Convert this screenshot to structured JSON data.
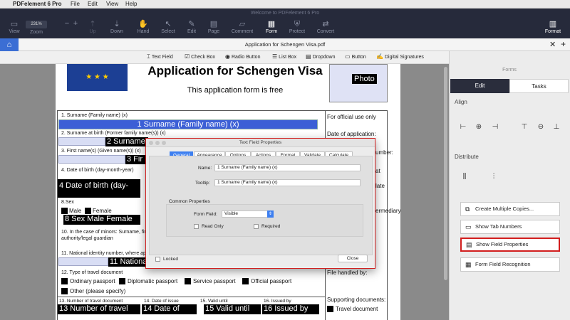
{
  "macbar": {
    "app_name": "PDFelement 6 Pro",
    "menus": [
      "File",
      "Edit",
      "View",
      "Help"
    ]
  },
  "window": {
    "title": "Welcome to PDFelement 6 Pro"
  },
  "toolbar": {
    "zoom_value": "231%",
    "items": {
      "view": "View",
      "zoom": "Zoom",
      "up": "Up",
      "down": "Down",
      "hand": "Hand",
      "select": "Select",
      "edit": "Edit",
      "page": "Page",
      "comment": "Comment",
      "form": "Form",
      "protect": "Protect",
      "convert": "Convert",
      "format": "Format"
    }
  },
  "tab": {
    "filename": "Application for Schengen Visa.pdf"
  },
  "formbar": {
    "text_field": "Text Field",
    "check_box": "Check Box",
    "radio_button": "Radio Button",
    "list_box": "List Box",
    "dropdown": "Dropdown",
    "button": "Button",
    "digital_signatures": "Digital Signatures"
  },
  "document": {
    "title": "Application for Schengen Visa",
    "subtitle": "This application form is free",
    "photo": "Photo",
    "official_use": "For official use only",
    "date_of_application": "Date of application:",
    "number_fragment": "umber:",
    "at_fragment": "at",
    "late_fragment": "late",
    "intermediary_fragment": "ermediary",
    "file_handled": "File handled by:",
    "supporting_documents": "Supporting documents:",
    "travel_document_opt": "Travel document",
    "f1_label": "1. Surname (Family name) (x)",
    "f1_field": "1  Surname (Family name) (x)",
    "f2_label": "2. Surname at birth (Former family name(s)) (x)",
    "f2_field": "2  Surname",
    "f3_label": "3. First name(s) (Given name(s)) (x)",
    "f3_field": "3  Fir",
    "f4_label": "4. Date of birth (day-month-year)",
    "f4_field": "4  Date of birth (day-",
    "f8_label": "8.Sex",
    "male": "Male",
    "female": "Female",
    "f8_field": "8 Sex Male Female",
    "f10_label_a": "10. In the case of minors: Surname, fir",
    "f10_label_b": "authority/legal guardian",
    "f11_label": "11. National identity number, where ap",
    "f11_field": "11  Nationa",
    "f12_label": "12. Type of travel document",
    "ordinary_passport": "Ordinary passport",
    "diplomatic_passport": "Diplomatic passport",
    "service_passport": "Service passport",
    "official_passport": "Official passport",
    "other": "Other (please specify)",
    "f13_label": "13. Number of travel document",
    "f13_field": "13  Number of travel",
    "f14_label": "14. Date of issue",
    "f14_field": "14  Date of",
    "f15_label": "15. Valid until",
    "f15_field": "15  Valid until",
    "f16_label": "16. Issued by",
    "f16_field": "16  Issued by"
  },
  "panel": {
    "title": "Forms",
    "tab_edit": "Edit",
    "tab_tasks": "Tasks",
    "align": "Align",
    "distribute": "Distribute",
    "btn_multiple": "Create Multiple Copies...",
    "btn_tab_numbers": "Show Tab Numbers",
    "btn_field_props": "Show Field Properties",
    "btn_recognition": "Form Field Recognition"
  },
  "dialog": {
    "title": "Text Field Properties",
    "tabs": [
      "General",
      "Appearance",
      "Options",
      "Actions",
      "Format",
      "Validate",
      "Calculate"
    ],
    "name_label": "Name:",
    "name_value": "1  Surname (Family name) (x)",
    "tooltip_label": "Tooltip:",
    "tooltip_value": "1  Surname (Family name) (x)",
    "common_props": "Common Properties",
    "form_field_label": "Form Field:",
    "form_field_value": "Visible",
    "read_only": "Read Only",
    "required": "Required",
    "locked": "Locked",
    "close": "Close"
  }
}
